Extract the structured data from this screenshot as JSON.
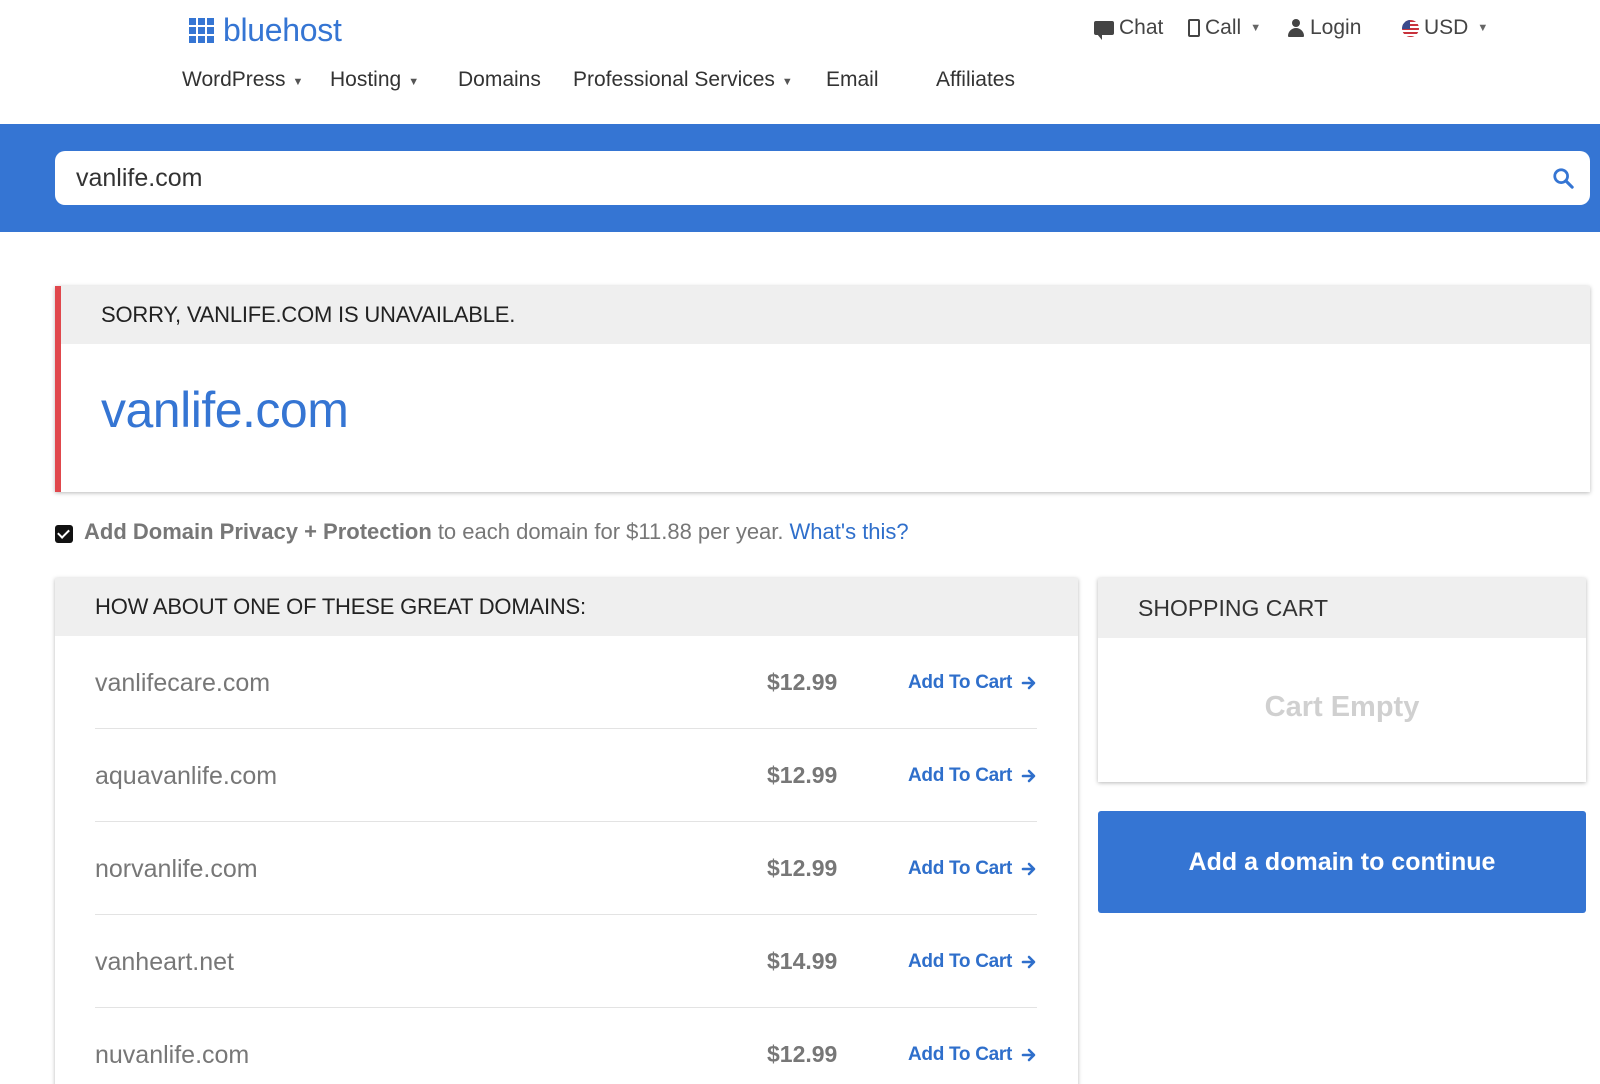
{
  "brand": {
    "name": "bluehost",
    "color": "#3575d3"
  },
  "utility_nav": {
    "chat": "Chat",
    "call": "Call",
    "login": "Login",
    "currency": "USD"
  },
  "main_nav": {
    "items": [
      {
        "label": "WordPress",
        "dropdown": true
      },
      {
        "label": "Hosting",
        "dropdown": true
      },
      {
        "label": "Domains",
        "dropdown": false
      },
      {
        "label": "Professional Services",
        "dropdown": true
      },
      {
        "label": "Email",
        "dropdown": false
      },
      {
        "label": "Affiliates",
        "dropdown": false
      }
    ]
  },
  "search": {
    "value": "vanlife.com"
  },
  "unavailable": {
    "heading": "SORRY, VANLIFE.COM IS UNAVAILABLE.",
    "domain": "vanlife.com",
    "accent_color": "#e0474c"
  },
  "privacy": {
    "checked": true,
    "strong_text": "Add Domain Privacy + Protection",
    "text": "to each domain for $11.88 per year.",
    "link": "What's this?"
  },
  "suggestions": {
    "heading": "HOW ABOUT ONE OF THESE GREAT DOMAINS:",
    "items": [
      {
        "domain": "vanlifecare.com",
        "price": "$12.99",
        "action": "Add To Cart"
      },
      {
        "domain": "aquavanlife.com",
        "price": "$12.99",
        "action": "Add To Cart"
      },
      {
        "domain": "norvanlife.com",
        "price": "$12.99",
        "action": "Add To Cart"
      },
      {
        "domain": "vanheart.net",
        "price": "$14.99",
        "action": "Add To Cart"
      },
      {
        "domain": "nuvanlife.com",
        "price": "$12.99",
        "action": "Add To Cart"
      }
    ]
  },
  "cart": {
    "heading": "SHOPPING CART",
    "empty_text": "Cart Empty",
    "continue_label": "Add a domain to continue"
  }
}
